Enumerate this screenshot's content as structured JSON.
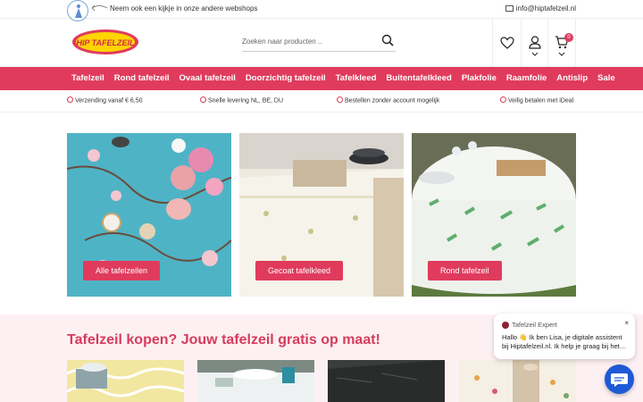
{
  "topbar": {
    "other_shops": "Neem ook een kijkje in onze andere webshops",
    "email": "info@hiptafelzeil.nl"
  },
  "header": {
    "brand": "HIP TAFELZEIL",
    "search_placeholder": "Zoeken naar producten ..",
    "cart_count": "0",
    "icons": [
      "heart-icon",
      "user-icon",
      "cart-icon",
      "search-icon"
    ]
  },
  "nav": {
    "items": [
      "Tafelzeil",
      "Rond tafelzeil",
      "Ovaal tafelzeil",
      "Doorzichtig tafelzeil",
      "Tafelkleed",
      "Buitentafelkleed",
      "Plakfolie",
      "Raamfolie",
      "Antislip",
      "Sale"
    ]
  },
  "usps": [
    "Verzending vanaf € 6,50",
    "Snelle levering NL, BE, DU",
    "Bestellen zonder account mogelijk",
    "Veilig betalen met iDeal"
  ],
  "tiles": [
    {
      "cta": "Alle tafelzeilen"
    },
    {
      "cta": "Gecoat tafelkleed"
    },
    {
      "cta": "Rond tafelzeil"
    }
  ],
  "promo": {
    "title": "Tafelzeil kopen? Jouw tafelzeil gratis op maat!"
  },
  "chat": {
    "agent": "Tafelzeil Expert",
    "close": "×",
    "message": "Hallo 👋 Ik ben Lisa, je digitale assistent bij Hiptafelzeil.nl. Ik help je graag bij het…"
  },
  "colors": {
    "accent": "#e03b5d",
    "promo_bg": "#fdf0f3",
    "chat_button": "#1f5ad6"
  }
}
